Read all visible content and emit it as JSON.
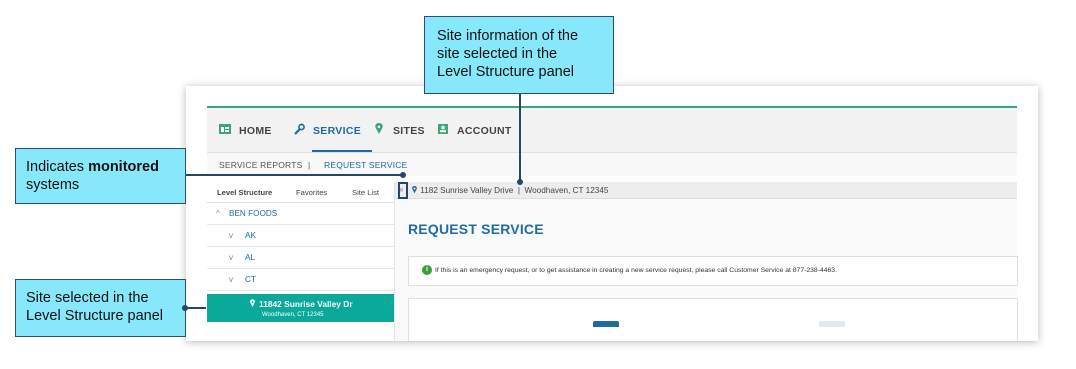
{
  "nav": {
    "items": [
      {
        "label": "HOME",
        "icon": "home-grid-icon"
      },
      {
        "label": "SERVICE",
        "icon": "wrench-icon"
      },
      {
        "label": "SITES",
        "icon": "location-pin-icon"
      },
      {
        "label": "ACCOUNT",
        "icon": "account-card-icon"
      }
    ],
    "active_color": "#1e6aa8",
    "accent_line_color": "#3aa67a"
  },
  "subnav": {
    "service_reports": "SERVICE REPORTS",
    "separator": "|",
    "request_service": "REQUEST SERVICE"
  },
  "sidebar": {
    "tabs": [
      "Level Structure",
      "Favorites",
      "Site List"
    ],
    "tree": [
      {
        "toggle": "^",
        "label": "BEN FOODS"
      },
      {
        "toggle": "v",
        "label": "AK"
      },
      {
        "toggle": "v",
        "label": "AL"
      },
      {
        "toggle": "v",
        "label": "CT"
      }
    ],
    "selected_site": {
      "name": "11842 Sunrise Valley Dr",
      "city": "Woodhaven, CT 12345"
    },
    "selected_color": "#0aa99a"
  },
  "site_bar": {
    "collapse": "«",
    "address": "1182 Sunrise Valley Drive",
    "separator": "|",
    "city": "Woodhaven, CT 12345"
  },
  "main": {
    "title": "REQUEST SERVICE",
    "alert": "If this is an emergency request, or to get assistance in creating a new service request, please call Customer Service at 877-238-4463."
  },
  "callouts": {
    "site_info": [
      "Site information of the",
      "site selected in the",
      "Level Structure panel"
    ],
    "monitored": {
      "prefix": "Indicates",
      "bold": "monitored",
      "line2": "systems"
    },
    "site_selected": [
      "Site selected in the",
      "Level Structure panel"
    ]
  }
}
